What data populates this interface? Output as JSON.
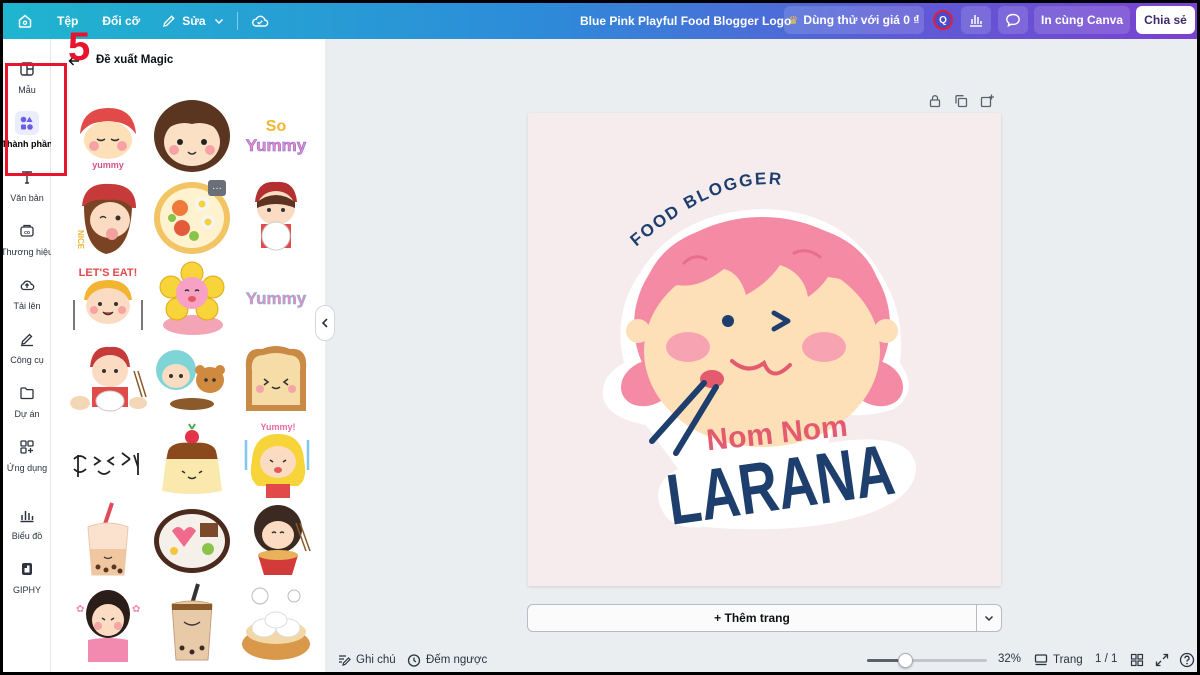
{
  "topbar": {
    "menu": [
      "Tệp",
      "Đổi cỡ",
      "Sửa"
    ],
    "title": "Blue Pink Playful Food Blogger Logo",
    "trial_label": "Dùng thử với giá 0 ₫",
    "avatar_letter": "Q",
    "print_label": "In cùng Canva",
    "share_label": "Chia sẻ",
    "gradient_colors": [
      "#1fb5cf",
      "#2d8bd9",
      "#5d5bd6",
      "#7b41d0"
    ]
  },
  "rail": {
    "items": [
      {
        "label": "Mẫu",
        "icon": "template-icon"
      },
      {
        "label": "Thành phần",
        "icon": "elements-icon",
        "active": true
      },
      {
        "label": "Văn bản",
        "icon": "text-icon"
      },
      {
        "label": "Thương hiệu",
        "icon": "brand-icon"
      },
      {
        "label": "Tải lên",
        "icon": "upload-icon"
      },
      {
        "label": "Công cụ",
        "icon": "draw-icon"
      },
      {
        "label": "Dự án",
        "icon": "folder-icon"
      },
      {
        "label": "Ứng dụng",
        "icon": "apps-icon"
      },
      {
        "label": "Biểu đồ",
        "icon": "chart-icon"
      },
      {
        "label": "GIPHY",
        "icon": "giphy-icon"
      }
    ]
  },
  "annotation": {
    "step": "5",
    "color": "#e8142d"
  },
  "panel": {
    "title": "Đề xuất Magic",
    "stickers": [
      {
        "kind": "girl-face"
      },
      {
        "kind": "girl-face-brown"
      },
      {
        "kind": "text",
        "text": "So Yummy"
      },
      {
        "kind": "girl-wink"
      },
      {
        "kind": "food-bowl"
      },
      {
        "kind": "girl-plate"
      },
      {
        "kind": "text",
        "text": "LET'S EAT!"
      },
      {
        "kind": "flower"
      },
      {
        "kind": "text",
        "text": "Yummy"
      },
      {
        "kind": "girl-eating"
      },
      {
        "kind": "kids-eating"
      },
      {
        "kind": "toast"
      },
      {
        "kind": "faces"
      },
      {
        "kind": "pudding"
      },
      {
        "kind": "text",
        "text": "Yummy!"
      },
      {
        "kind": "boba"
      },
      {
        "kind": "bento"
      },
      {
        "kind": "girl-noodles"
      },
      {
        "kind": "girl-cheeks"
      },
      {
        "kind": "boba-dark"
      },
      {
        "kind": "dumplings"
      }
    ]
  },
  "design": {
    "arc_text": "FOOD BLOGGER",
    "tagline": "Nom Nom",
    "name": "LARANA",
    "bg": "#f6ecee",
    "hair": "#f48aa3",
    "skin": "#fde0b8",
    "navy": "#1e3f6e",
    "pink_text": "#e45a6e"
  },
  "add_page_label": "+ Thêm trang",
  "bottombar": {
    "notes_label": "Ghi chú",
    "timer_label": "Đếm ngược",
    "zoom": "32%",
    "zoom_fraction": 0.32,
    "pages_label": "Trang",
    "page_count": "1 / 1"
  }
}
